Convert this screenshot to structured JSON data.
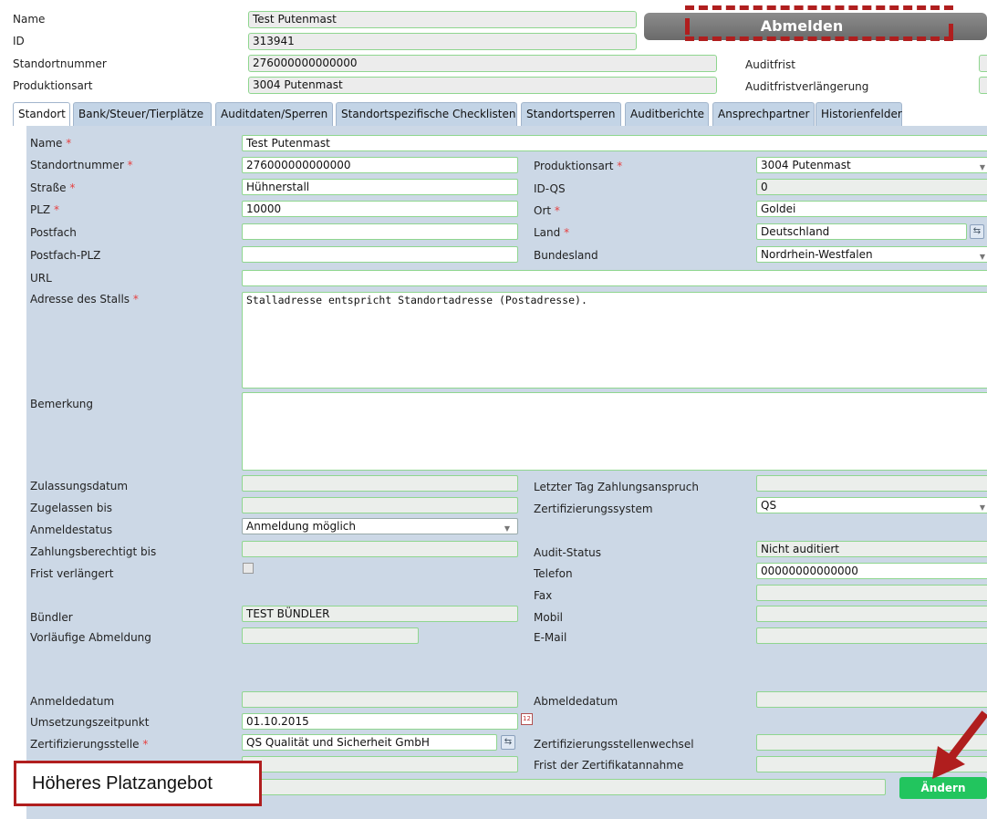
{
  "header": {
    "labels": {
      "name": "Name",
      "id": "ID",
      "standortnummer": "Standortnummer",
      "produktionsart": "Produktionsart"
    },
    "values": {
      "name": "Test Putenmast",
      "id": "313941",
      "standortnummer": "276000000000000",
      "produktionsart": "3004 Putenmast"
    },
    "abmelden_label": "Abmelden",
    "auditfrist_label": "Auditfrist",
    "auditfristverlaengerung_label": "Auditfristverlängerung"
  },
  "tabs": [
    {
      "label": "Standort"
    },
    {
      "label": "Bank/Steuer/Tierplätze"
    },
    {
      "label": "Auditdaten/Sperren"
    },
    {
      "label": "Standortspezifische Checklisten"
    },
    {
      "label": "Standortsperren"
    },
    {
      "label": "Auditberichte"
    },
    {
      "label": "Ansprechpartner"
    },
    {
      "label": "Historienfelder"
    }
  ],
  "form": {
    "name": {
      "label": "Name",
      "value": "Test Putenmast"
    },
    "standortnummer": {
      "label": "Standortnummer",
      "value": "276000000000000"
    },
    "strasse": {
      "label": "Straße",
      "value": "Hühnerstall"
    },
    "plz": {
      "label": "PLZ",
      "value": "10000"
    },
    "postfach": {
      "label": "Postfach",
      "value": ""
    },
    "postfach_plz": {
      "label": "Postfach-PLZ",
      "value": ""
    },
    "url": {
      "label": "URL",
      "value": ""
    },
    "adresse_stall": {
      "label": "Adresse des Stalls",
      "value": "Stalladresse entspricht Standortadresse (Postadresse)."
    },
    "bemerkung": {
      "label": "Bemerkung",
      "value": ""
    },
    "produktionsart": {
      "label": "Produktionsart",
      "value": "3004 Putenmast"
    },
    "id_qs": {
      "label": "ID-QS",
      "value": "0"
    },
    "ort": {
      "label": "Ort",
      "value": "Goldei"
    },
    "land": {
      "label": "Land",
      "value": "Deutschland"
    },
    "bundesland": {
      "label": "Bundesland",
      "value": "Nordrhein-Westfalen"
    },
    "zulassungsdatum": {
      "label": "Zulassungsdatum",
      "value": ""
    },
    "zugelassen_bis": {
      "label": "Zugelassen bis",
      "value": ""
    },
    "anmeldestatus": {
      "label": "Anmeldestatus",
      "value": "Anmeldung möglich"
    },
    "zahlungsberechtigt_bis": {
      "label": "Zahlungsberechtigt bis",
      "value": ""
    },
    "frist_verlaengert": {
      "label": "Frist verlängert",
      "checked": false
    },
    "letzter_tag": {
      "label": "Letzter Tag Zahlungsanspruch",
      "value": ""
    },
    "zertifizierungssystem": {
      "label": "Zertifizierungssystem",
      "value": "QS"
    },
    "audit_status": {
      "label": "Audit-Status",
      "value": "Nicht auditiert"
    },
    "telefon": {
      "label": "Telefon",
      "value": "00000000000000"
    },
    "fax": {
      "label": "Fax",
      "value": ""
    },
    "buendler": {
      "label": "Bündler",
      "value": "TEST BÜNDLER"
    },
    "mobil": {
      "label": "Mobil",
      "value": ""
    },
    "vorlaeufige_abmeldung": {
      "label": "Vorläufige Abmeldung",
      "value": ""
    },
    "email": {
      "label": "E-Mail",
      "value": ""
    },
    "anmeldedatum": {
      "label": "Anmeldedatum",
      "value": ""
    },
    "abmeldedatum": {
      "label": "Abmeldedatum",
      "value": ""
    },
    "umsetzungszeitpunkt": {
      "label": "Umsetzungszeitpunkt",
      "value": "01.10.2015"
    },
    "zertifizierungsstelle": {
      "label": "Zertifizierungsstelle",
      "value": "QS Qualität und Sicherheit GmbH"
    },
    "zertifizierungsstellenwechsel": {
      "label": "Zertifizierungsstellenwechsel",
      "value": ""
    },
    "frist_zertifikatannahme": {
      "label": "Frist der Zertifikatannahme",
      "value": ""
    }
  },
  "annotation": {
    "callout_text": "Höheres Platzangebot"
  },
  "aendern_label": "Ändern",
  "colors": {
    "accent_green": "#22c55e",
    "field_border": "#8fd68f",
    "panel_bg": "#ccd8e6",
    "tab_bg": "#c3d4e6",
    "annotation_red": "#b01e1e"
  }
}
